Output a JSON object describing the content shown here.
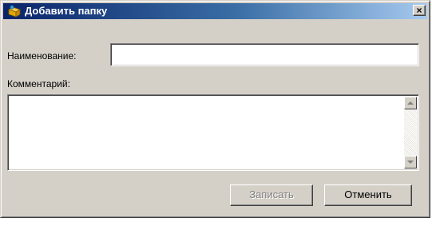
{
  "dialog": {
    "title": "Добавить папку",
    "icon": "folder-add-icon",
    "close_label": "×"
  },
  "form": {
    "name_label": "Наименование:",
    "name_value": "",
    "comment_label": "Комментарий:",
    "comment_value": ""
  },
  "buttons": {
    "save_label": "Записать",
    "save_enabled": false,
    "cancel_label": "Отменить"
  },
  "colors": {
    "titlebar_start": "#0a246a",
    "titlebar_end": "#a6caf0",
    "face": "#d4d0c8"
  }
}
